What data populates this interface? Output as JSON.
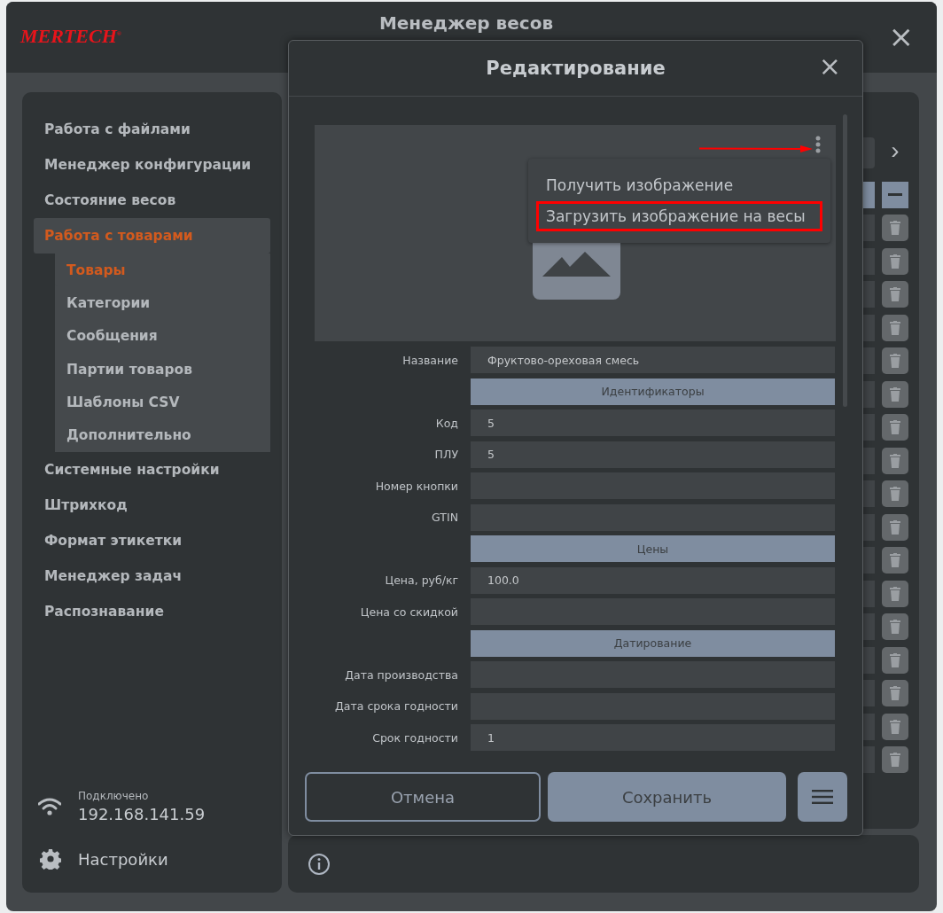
{
  "app": {
    "logo": "MERTECH$^{®}$",
    "title": "Менеджер весов",
    "close": "×"
  },
  "sidebar": {
    "items": [
      {
        "label": "Работа с файлами",
        "selected": false
      },
      {
        "label": "Менеджер конфигурации",
        "selected": false
      },
      {
        "label": "Состояние весов",
        "selected": false
      },
      {
        "label": "Работа с товарами",
        "selected": true,
        "expanded": true,
        "children": [
          {
            "label": "Товары",
            "selected": true
          },
          {
            "label": "Категории",
            "selected": false
          },
          {
            "label": "Сообщения",
            "selected": false
          },
          {
            "label": "Партии товаров",
            "selected": false
          },
          {
            "label": "Шаблоны CSV",
            "selected": false
          },
          {
            "label": "Дополнительно",
            "selected": false
          }
        ]
      },
      {
        "label": "Системные настройки",
        "selected": false
      },
      {
        "label": "Штрихкод",
        "selected": false
      },
      {
        "label": "Формат этикетки",
        "selected": false
      },
      {
        "label": "Менеджер задач",
        "selected": false
      },
      {
        "label": "Распознавание",
        "selected": false
      }
    ],
    "connection": {
      "status": "Подключено",
      "address": "192.168.141.59"
    },
    "settings": "Настройки"
  },
  "dialog": {
    "title": "Редактирование",
    "close": "×",
    "image_menu": [
      {
        "label": "Получить изображение",
        "highlighted": false
      },
      {
        "label": "Загрузить изображение на весы",
        "highlighted": true
      }
    ],
    "rows": [
      {
        "kind": "field",
        "label": "Название",
        "value": "Фруктово-ореховая смесь"
      },
      {
        "kind": "section",
        "label": "Идентификаторы"
      },
      {
        "kind": "field",
        "label": "Код",
        "value": "5"
      },
      {
        "kind": "field",
        "label": "ПЛУ",
        "value": "5"
      },
      {
        "kind": "field",
        "label": "Номер кнопки"
      },
      {
        "kind": "field",
        "label": "GTIN"
      },
      {
        "kind": "section",
        "label": "Цены"
      },
      {
        "kind": "field",
        "label": "Цена, руб/кг",
        "value": "100.0"
      },
      {
        "kind": "field",
        "label": "Цена со скидкой"
      },
      {
        "kind": "section",
        "label": "Датирование"
      },
      {
        "kind": "field",
        "label": "Дата производства"
      },
      {
        "kind": "field",
        "label": "Дата срока годности"
      },
      {
        "kind": "field",
        "label": "Срок годности",
        "value": "1"
      }
    ],
    "buttons": [
      {
        "kind": "outline",
        "label": "Отмена"
      },
      {
        "kind": "filled",
        "label": "Сохранить"
      }
    ]
  },
  "background": {
    "next": "›"
  }
}
